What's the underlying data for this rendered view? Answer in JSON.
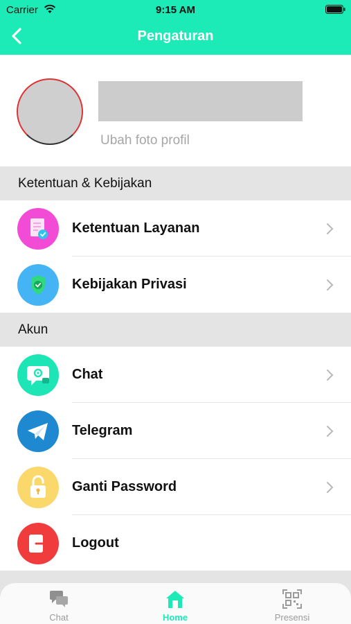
{
  "status_bar": {
    "carrier": "Carrier",
    "time": "9:15 AM"
  },
  "header": {
    "title": "Pengaturan",
    "back_icon": "chevron-left-icon"
  },
  "profile": {
    "change_photo": "Ubah foto profil"
  },
  "sections": {
    "policy": {
      "title": "Ketentuan & Kebijakan"
    },
    "account": {
      "title": "Akun"
    }
  },
  "rows": {
    "terms": {
      "label": "Ketentuan Layanan",
      "icon": "document-check-icon",
      "color": "#f24bd6"
    },
    "privacy": {
      "label": "Kebijakan Privasi",
      "icon": "shield-check-icon",
      "color": "#45b4f5"
    },
    "chat": {
      "label": "Chat",
      "icon": "chat-settings-icon",
      "color": "#1de5b5"
    },
    "telegram": {
      "label": "Telegram",
      "icon": "telegram-icon",
      "color": "#1e88d0"
    },
    "password": {
      "label": "Ganti Password",
      "icon": "padlock-icon",
      "color": "#fbd86b"
    },
    "logout": {
      "label": "Logout",
      "icon": "logout-icon",
      "color": "#f03c3c"
    }
  },
  "tabs": [
    {
      "label": "Chat",
      "icon": "chat-bubbles-icon",
      "active": false
    },
    {
      "label": "Home",
      "icon": "home-icon",
      "active": true
    },
    {
      "label": "Presensi",
      "icon": "qr-code-icon",
      "active": false
    }
  ],
  "colors": {
    "accent": "#1ceab7",
    "section_bg": "#e4e4e4"
  }
}
